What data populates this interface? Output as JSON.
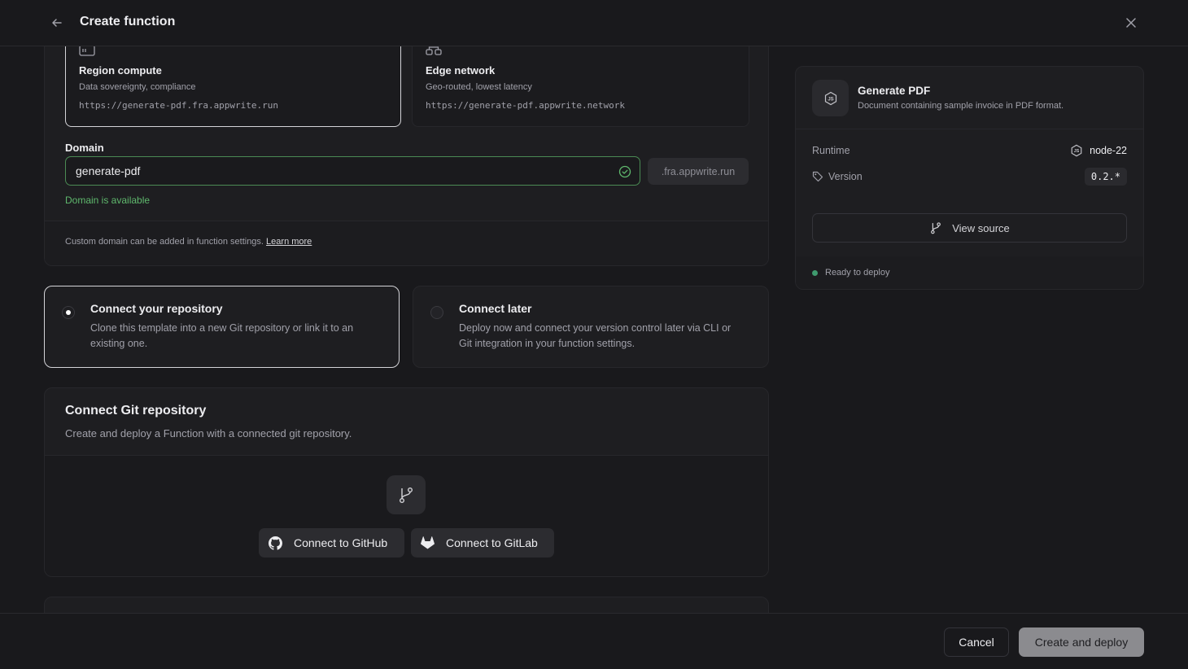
{
  "header": {
    "title": "Create function"
  },
  "deployment": {
    "options": [
      {
        "title": "Region compute",
        "subtitle": "Data sovereignty, compliance",
        "url": "https://generate-pdf.fra.appwrite.run",
        "selected": true,
        "icon": "server-icon"
      },
      {
        "title": "Edge network",
        "subtitle": "Geo-routed, lowest latency",
        "url": "https://generate-pdf.appwrite.network",
        "selected": false,
        "icon": "network-icon"
      }
    ],
    "domain_label": "Domain",
    "domain_value": "generate-pdf",
    "domain_suffix": ".fra.appwrite.run",
    "domain_status": "Domain is available",
    "footnote": "Custom domain can be added in function settings.",
    "footnote_link": "Learn more"
  },
  "repo_choice": [
    {
      "title": "Connect your repository",
      "desc": "Clone this template into a new Git repository or link it to an existing one.",
      "selected": true
    },
    {
      "title": "Connect later",
      "desc": "Deploy now and connect your version control later via CLI or Git integration in your function settings.",
      "selected": false
    }
  ],
  "git": {
    "title": "Connect Git repository",
    "subtitle": "Create and deploy a Function with a connected git repository.",
    "github_label": "Connect to GitHub",
    "gitlab_label": "Connect to GitLab"
  },
  "summary": {
    "name": "Generate PDF",
    "desc": "Document containing sample invoice in PDF format.",
    "runtime_label": "Runtime",
    "runtime_value": "node-22",
    "version_label": "Version",
    "version_value": "0.2.*",
    "view_source_label": "View source",
    "status": "Ready to deploy",
    "status_color": "#3f9a6e"
  },
  "footer": {
    "cancel_label": "Cancel",
    "create_label": "Create and deploy"
  }
}
